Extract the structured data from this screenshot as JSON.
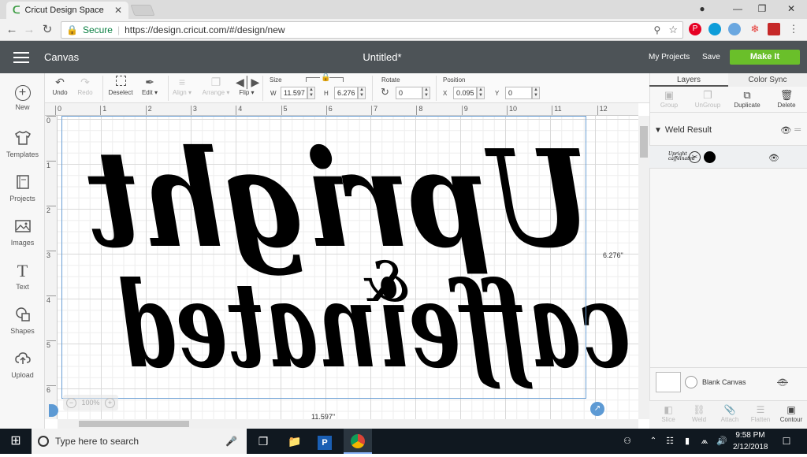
{
  "browser": {
    "tab_title": "Cricut Design Space",
    "tab_close": "✕",
    "url_secure": "Secure",
    "url": "https://design.cricut.com/#/design/new",
    "ext_colors": [
      "#e60023",
      "#0e9dd9",
      "#6aa7e0",
      "#e53935",
      "#c62828"
    ]
  },
  "header": {
    "canvas_label": "Canvas",
    "doc_title": "Untitled*",
    "my_projects": "My Projects",
    "save": "Save",
    "make_it": "Make It",
    "accent": "#6abf2a"
  },
  "sidebar": {
    "items": [
      {
        "label": "New",
        "icon": "plus-circle-icon"
      },
      {
        "label": "Templates",
        "icon": "tshirt-icon"
      },
      {
        "label": "Projects",
        "icon": "book-icon"
      },
      {
        "label": "Images",
        "icon": "image-icon"
      },
      {
        "label": "Text",
        "icon": "text-icon"
      },
      {
        "label": "Shapes",
        "icon": "shapes-icon"
      },
      {
        "label": "Upload",
        "icon": "upload-icon"
      }
    ]
  },
  "toolbar": {
    "undo": "Undo",
    "redo": "Redo",
    "deselect": "Deselect",
    "edit": "Edit",
    "align": "Align",
    "arrange": "Arrange",
    "flip": "Flip",
    "size_label": "Size",
    "w_label": "W",
    "w_value": "11.597",
    "h_label": "H",
    "h_value": "6.276",
    "rotate_label": "Rotate",
    "rotate_value": "0",
    "position_label": "Position",
    "x_label": "X",
    "x_value": "0.095",
    "y_label": "Y",
    "y_value": "0"
  },
  "rulers": {
    "h_ticks": [
      "0",
      "1",
      "2",
      "3",
      "4",
      "5",
      "6",
      "7",
      "8",
      "9",
      "10",
      "11",
      "12"
    ],
    "v_ticks": [
      "0",
      "1",
      "2",
      "3",
      "4",
      "5",
      "6"
    ]
  },
  "canvas": {
    "line1": "Upright",
    "amp": "&",
    "line2": "caffeinated",
    "height_readout": "6.276\"",
    "width_readout": "11.597\"",
    "zoom": "100%"
  },
  "layers": {
    "tab_layers": "Layers",
    "tab_color_sync": "Color Sync",
    "tools": [
      "Group",
      "UnGroup",
      "Duplicate",
      "Delete"
    ],
    "weld_result": "Weld Result",
    "thumb_text": "Upright caffeinated",
    "blank_canvas": "Blank Canvas",
    "bottom_tools": [
      "Slice",
      "Weld",
      "Attach",
      "Flatten",
      "Contour"
    ]
  },
  "taskbar": {
    "search_placeholder": "Type here to search",
    "time": "9:58 PM",
    "date": "2/12/2018"
  }
}
